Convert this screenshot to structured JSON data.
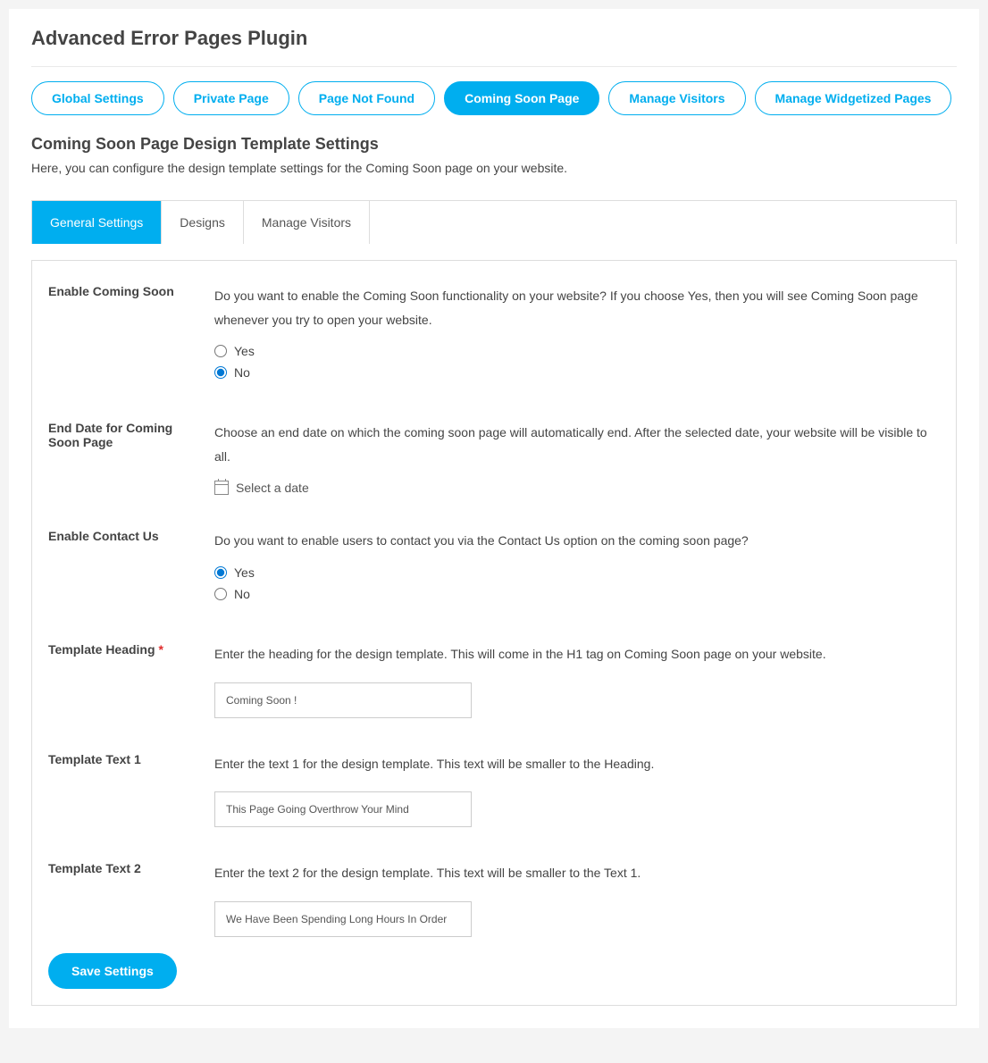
{
  "page_title": "Advanced Error Pages Plugin",
  "pills": [
    {
      "label": "Global Settings",
      "active": false
    },
    {
      "label": "Private Page",
      "active": false
    },
    {
      "label": "Page Not Found",
      "active": false
    },
    {
      "label": "Coming Soon Page",
      "active": true
    },
    {
      "label": "Manage Visitors",
      "active": false
    },
    {
      "label": "Manage Widgetized Pages",
      "active": false
    }
  ],
  "section_title": "Coming Soon Page Design Template Settings",
  "section_desc": "Here, you can configure the design template settings for the Coming Soon page on your website.",
  "tabs": [
    {
      "label": "General Settings",
      "active": true
    },
    {
      "label": "Designs",
      "active": false
    },
    {
      "label": "Manage Visitors",
      "active": false
    }
  ],
  "form": {
    "enable_coming_soon": {
      "label": "Enable Coming Soon",
      "help": "Do you want to enable the Coming Soon functionality on your website? If you choose Yes, then you will see Coming Soon page whenever you try to open your website.",
      "yes": "Yes",
      "no": "No",
      "value": "no"
    },
    "end_date": {
      "label": "End Date for Coming Soon Page",
      "help": "Choose an end date on which the coming soon page will automatically end. After the selected date, your website will be visible to all.",
      "picker_text": "Select a date"
    },
    "enable_contact": {
      "label": "Enable Contact Us",
      "help": "Do you want to enable users to contact you via the Contact Us option on the coming soon page?",
      "yes": "Yes",
      "no": "No",
      "value": "yes"
    },
    "template_heading": {
      "label": "Template Heading",
      "required": "*",
      "help": "Enter the heading for the design template. This will come in the H1 tag on Coming Soon page on your website.",
      "value": "Coming Soon !"
    },
    "template_text1": {
      "label": "Template Text 1",
      "help": "Enter the text 1 for the design template. This text will be smaller to the Heading.",
      "value": "This Page Going Overthrow Your Mind"
    },
    "template_text2": {
      "label": "Template Text 2",
      "help": "Enter the text 2 for the design template. This text will be smaller to the Text 1.",
      "value": "We Have Been Spending Long Hours In Order"
    }
  },
  "save_button": "Save Settings"
}
